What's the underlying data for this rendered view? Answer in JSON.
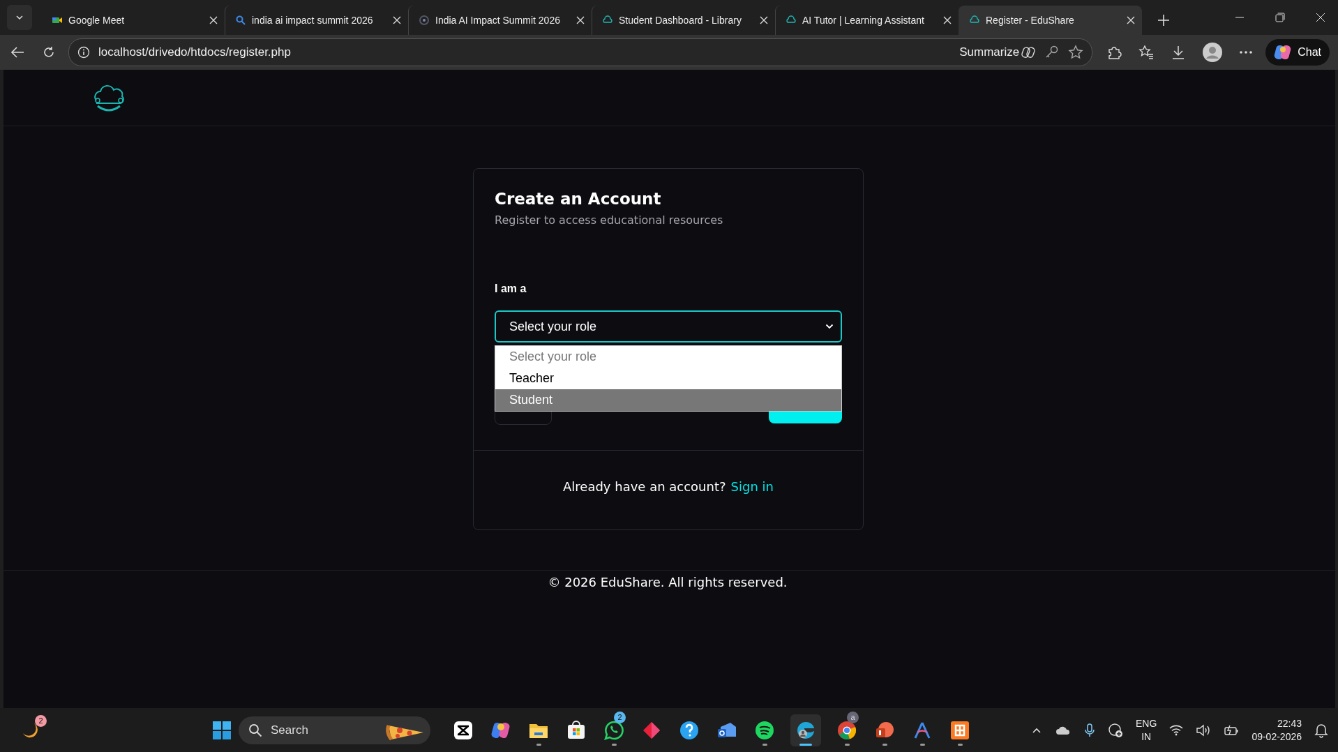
{
  "browser": {
    "tabs": [
      {
        "title": "Google Meet",
        "selected": false
      },
      {
        "title": "india ai impact summit 2026",
        "selected": false
      },
      {
        "title": "India AI Impact Summit 2026",
        "selected": false
      },
      {
        "title": "Student Dashboard - Library",
        "selected": false
      },
      {
        "title": "AI Tutor | Learning Assistant",
        "selected": false
      },
      {
        "title": "Register - EduShare",
        "selected": true
      }
    ],
    "address": "localhost/drivedo/htdocs/register.php",
    "summarize": "Summarize",
    "chat": "Chat"
  },
  "page": {
    "title": "Create an Account",
    "subtitle": "Register to access educational resources",
    "role_label": "I am a",
    "role_select": {
      "value": "Select your role"
    },
    "role_options": [
      {
        "label": "Select your role",
        "disabled": true,
        "selected": false
      },
      {
        "label": "Teacher",
        "disabled": false,
        "selected": false
      },
      {
        "label": "Student",
        "disabled": false,
        "selected": true
      }
    ],
    "signin_prompt": "Already have an account?",
    "signin_link": "Sign in",
    "copyright": "© 2026 EduShare. All rights reserved."
  },
  "taskbar": {
    "widget_badge": "2",
    "search_placeholder": "Search",
    "apps": [
      {
        "kind": "capcut",
        "running": false,
        "selected": false
      },
      {
        "kind": "copilot",
        "running": false,
        "selected": false
      },
      {
        "kind": "files",
        "running": true,
        "selected": false
      },
      {
        "kind": "store",
        "running": false,
        "selected": false
      },
      {
        "kind": "whatsapp",
        "running": true,
        "selected": false,
        "badge": "2"
      },
      {
        "kind": "diamond",
        "running": false,
        "selected": false
      },
      {
        "kind": "help",
        "running": false,
        "selected": false
      },
      {
        "kind": "outlook",
        "running": false,
        "selected": false
      },
      {
        "kind": "spotify",
        "running": true,
        "selected": false
      },
      {
        "kind": "edge",
        "running": true,
        "selected": true
      },
      {
        "kind": "chrome",
        "running": true,
        "selected": false,
        "badge": "a"
      },
      {
        "kind": "powerpoint",
        "running": true,
        "selected": false
      },
      {
        "kind": "arrow-app",
        "running": true,
        "selected": false
      },
      {
        "kind": "xampp",
        "running": true,
        "selected": false
      }
    ],
    "language": [
      "ENG",
      "IN"
    ],
    "time": "22:43",
    "date": "09-02-2026"
  }
}
